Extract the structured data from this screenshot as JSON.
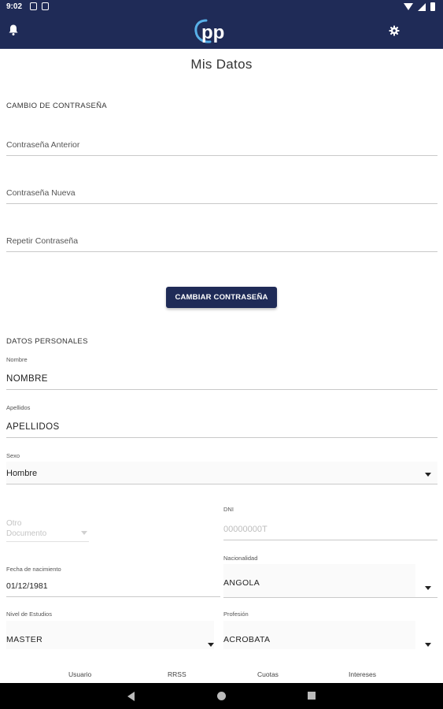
{
  "status_bar": {
    "time": "9:02",
    "left_icons": [
      "notification-icon",
      "sd-card-icon"
    ],
    "right_icons": [
      "wifi-icon",
      "signal-icon",
      "battery-icon"
    ]
  },
  "app_bar": {
    "left_icon": "bell-icon",
    "logo_text": "pp",
    "right_icon": "gear-icon",
    "background": "#1f2b57"
  },
  "page": {
    "title": "Mis Datos"
  },
  "password_section": {
    "title": "CAMBIO DE CONTRASEÑA",
    "fields": [
      {
        "placeholder": "Contraseña Anterior"
      },
      {
        "placeholder": "Contraseña Nueva"
      },
      {
        "placeholder": "Repetir Contraseña"
      }
    ],
    "button_label": "CAMBIAR CONTRASEÑA"
  },
  "personal_section": {
    "title": "DATOS PERSONALES",
    "nombre": {
      "label": "Nombre",
      "value": "NOMBRE"
    },
    "apellidos": {
      "label": "Apellidos",
      "value": "APELLIDOS"
    },
    "sexo": {
      "label": "Sexo",
      "value": "Hombre"
    },
    "otro_documento": {
      "label": "Otro Documento"
    },
    "dni": {
      "label": "DNI",
      "placeholder": "00000000T"
    },
    "fecha_nacimiento": {
      "label": "Fecha de nacimiento",
      "value": "01/12/1981"
    },
    "nacionalidad": {
      "label": "Nacionalidad",
      "value": "ANGOLA"
    },
    "nivel_estudios": {
      "label": "Nivel de Estudios",
      "value": "MASTER"
    },
    "profesion": {
      "label": "Profesión",
      "value": "ACROBATA"
    }
  },
  "bottom_tabs": [
    "Usuario",
    "RRSS",
    "Cuotas",
    "Intereses"
  ],
  "nav_bar": {
    "icons": [
      "back-icon",
      "home-icon",
      "recents-icon"
    ]
  }
}
